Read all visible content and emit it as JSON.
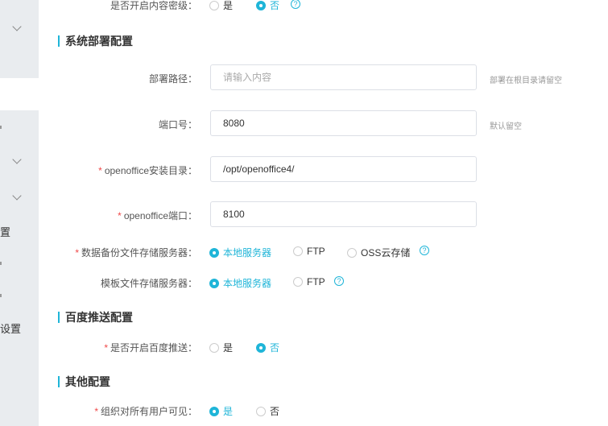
{
  "sidebar": {
    "fragments": [
      "置",
      "设置"
    ]
  },
  "top_row": {
    "label": "是否开启内容密级：",
    "options": [
      "是",
      "否"
    ],
    "selected": 1
  },
  "sections": [
    {
      "title": "系统部署配置"
    },
    {
      "title": "百度推送配置"
    },
    {
      "title": "其他配置"
    }
  ],
  "deploy": {
    "path": {
      "label": "部署路径：",
      "value": "",
      "placeholder": "请输入内容",
      "hint": "部署在根目录请留空"
    },
    "port": {
      "label": "端口号：",
      "value": "8080",
      "hint": "默认留空"
    },
    "oo_dir": {
      "required": "*",
      "label": "openoffice安装目录：",
      "value": "/opt/openoffice4/"
    },
    "oo_port": {
      "required": "*",
      "label": "openoffice端口：",
      "value": "8100"
    },
    "backup": {
      "required": "*",
      "label": "数据备份文件存储服务器：",
      "options": [
        "本地服务器",
        "FTP",
        "OSS云存储"
      ],
      "selected": 0
    },
    "template": {
      "label": "模板文件存储服务器：",
      "options": [
        "本地服务器",
        "FTP"
      ],
      "selected": 0
    }
  },
  "baidu": {
    "required": "*",
    "label": "是否开启百度推送：",
    "options": [
      "是",
      "否"
    ],
    "selected": 1
  },
  "other": {
    "required": "*",
    "label": "组织对所有用户可见：",
    "options": [
      "是",
      "否"
    ],
    "selected": 0
  },
  "help_glyph": "?",
  "colors": {
    "accent": "#1fb5d8",
    "required": "#f04848"
  }
}
